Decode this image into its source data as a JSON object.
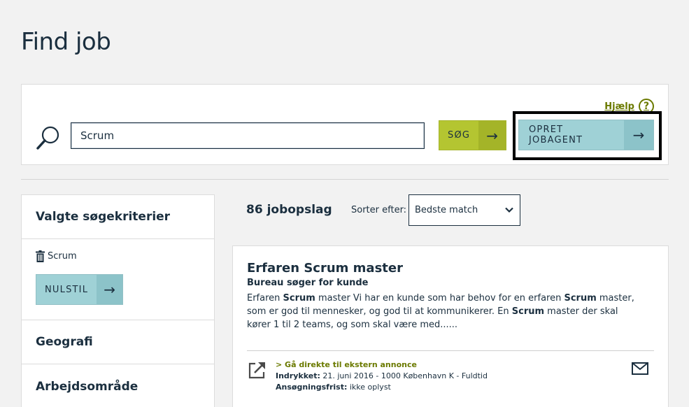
{
  "page": {
    "title": "Find job"
  },
  "search": {
    "help_label": "Hjælp",
    "help_symbol": "?",
    "query": "Scrum",
    "search_button_label": "SØG",
    "jobagent_button_label": "OPRET JOBAGENT",
    "arrow": "→"
  },
  "sidebar": {
    "criteria_heading": "Valgte søgekriterier",
    "chip_label": "Scrum",
    "reset_label": "NULSTIL",
    "geo_heading": "Geografi",
    "area_heading": "Arbejdsområde"
  },
  "results": {
    "count_label": "86 jobopslag",
    "sort_label": "Sorter efter:",
    "sort_value": "Bedste match"
  },
  "job": {
    "title": "Erfaren Scrum master",
    "company": "Bureau søger for kunde",
    "desc_parts": [
      "Erfaren ",
      "Scrum",
      " master Vi har en kunde som har behov for en erfaren ",
      "Scrum",
      " master, som er god til mennesker, og god til at kommunikerer. En ",
      "Scrum",
      " master der skal kører 1 til 2 teams, og som skal være med......"
    ],
    "ext_link": "> Gå direkte til ekstern annonce",
    "printed_label": "Indrykket:",
    "printed_value": "21. juni 2016 - 1000 København K - Fuldtid",
    "deadline_label": "Ansøgningsfrist:",
    "deadline_value": "ikke oplyst"
  },
  "colors": {
    "background": "#f2f2f2",
    "text": "#1b2f3f",
    "green_button": "#b4c531",
    "teal_button": "#9fd1d6",
    "link": "#6b7a00"
  },
  "icons": [
    "search-icon",
    "help-icon",
    "arrow-right-icon",
    "trash-icon",
    "chevron-down-icon",
    "external-link-icon",
    "mail-icon"
  ]
}
